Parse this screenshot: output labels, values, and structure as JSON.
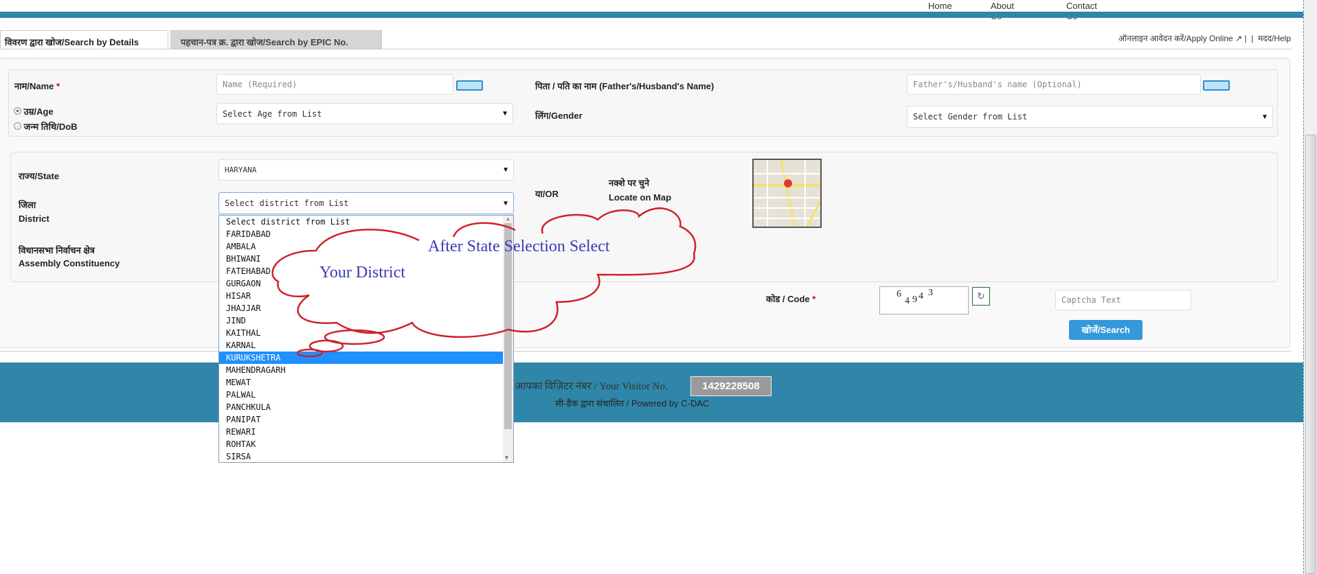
{
  "topnav": {
    "items": [
      "Home",
      "About Us",
      "Contact Us"
    ]
  },
  "tabs": [
    {
      "label": "विवरण द्वारा खोज/Search by Details",
      "active": true
    },
    {
      "label": "पहचान-पत्र क्र. द्वारा खोज/Search by EPIC No.",
      "active": false
    }
  ],
  "toplinks": {
    "apply": "ऑनलाइन आवेदन करें/Apply Online",
    "separator": "|",
    "help": "मदद/Help"
  },
  "form": {
    "name_label": "नाम/Name",
    "required": "*",
    "name_placeholder": "Name (Required)",
    "father_label": "पिता / पति का नाम (Father's/Husband's Name)",
    "father_placeholder": "Father's/Husband's name (Optional)",
    "age_label": "उम्र/Age",
    "dob_label": "जन्म तिथि/DoB",
    "age_selected": true,
    "age_select": "Select Age from List",
    "gender_label": "लिंग/Gender",
    "gender_select": "Select Gender from List",
    "state_label": "राज्य/State",
    "state_value": "HARYANA",
    "district_label_hi": "जिला",
    "district_label_en": "District",
    "district_select": "Select district from List",
    "assembly_label_hi": "विधानसभा निर्वाचन क्षेत्र",
    "assembly_label_en": "Assembly Constituency",
    "or_label": "या/OR",
    "map_label_hi": "नक्शे पर चुने",
    "map_label_en": "Locate on Map",
    "code_label": "कोड / Code",
    "captcha_digits": [
      "6",
      "4",
      "9",
      "4",
      "3"
    ],
    "captcha_placeholder": "Captcha Text",
    "search_button": "खोजें/Search"
  },
  "district_options": [
    "Select district from List",
    "FARIDABAD",
    "AMBALA",
    "BHIWANI",
    "FATEHABAD",
    "GURGAON",
    "HISAR",
    "JHAJJAR",
    "JIND",
    "KAITHAL",
    "KARNAL",
    "KURUKSHETRA",
    "MAHENDRAGARH",
    "MEWAT",
    "PALWAL",
    "PANCHKULA",
    "PANIPAT",
    "REWARI",
    "ROHTAK",
    "SIRSA"
  ],
  "highlighted_option": "KURUKSHETRA",
  "annotation": {
    "line1": "After State Selection Select",
    "line2": "Your District",
    "color": "#d0202a",
    "text_color": "#3a3ab8"
  },
  "footer": {
    "visitor_label": "आपका विज़िटर नंबर / Your Visitor No.",
    "visitor_number": "1429228508",
    "powered": "सी-डैक द्वारा संचालित / Powered by C-DAC"
  },
  "colors": {
    "brand": "#2f86a8",
    "button": "#3498db",
    "highlight": "#1e90ff"
  }
}
